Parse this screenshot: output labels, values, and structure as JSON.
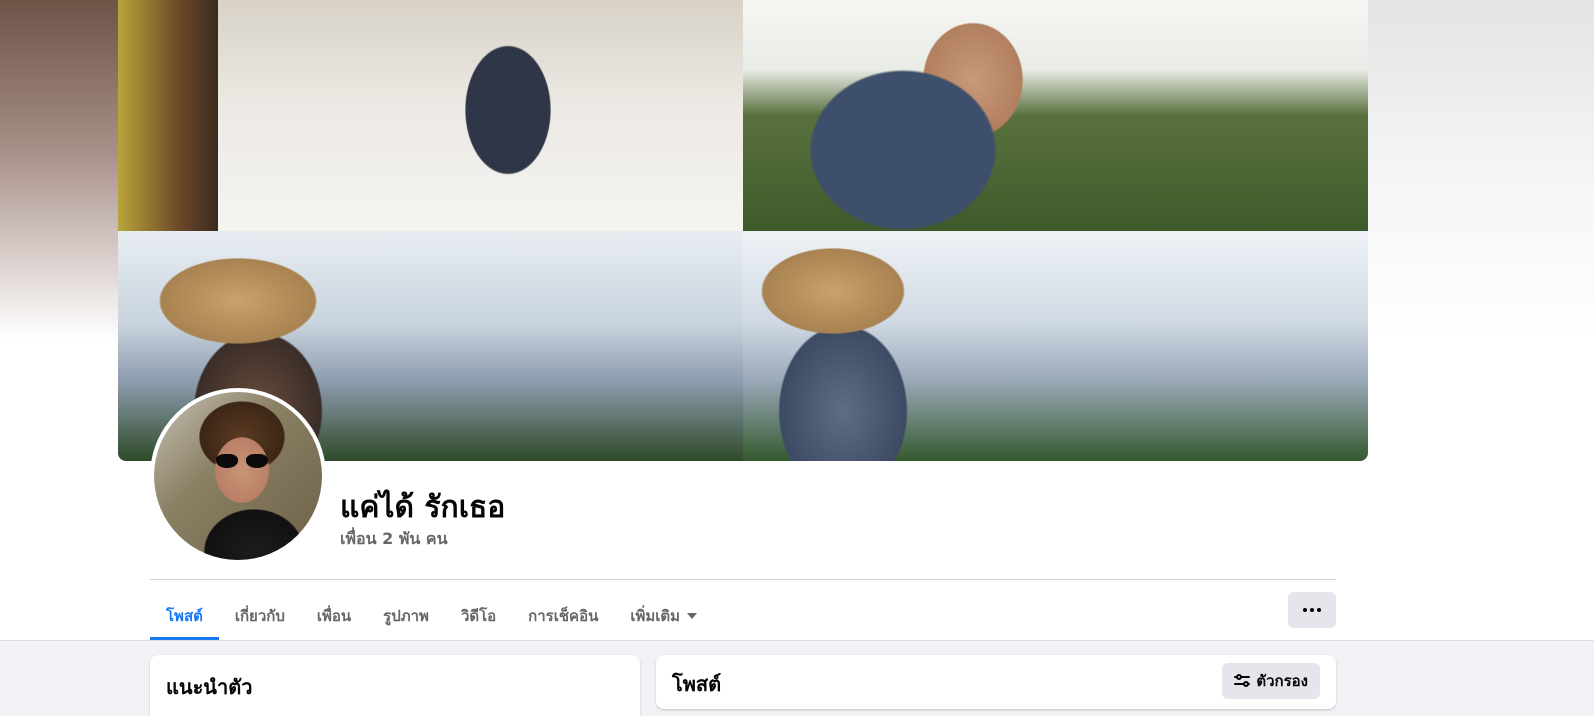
{
  "profile": {
    "name": "แค่ได้ รักเธอ",
    "friends": "เพื่อน 2 พัน คน"
  },
  "tabs": [
    {
      "label": "โพสต์",
      "active": true
    },
    {
      "label": "เกี่ยวกับ",
      "active": false
    },
    {
      "label": "เพื่อน",
      "active": false
    },
    {
      "label": "รูปภาพ",
      "active": false
    },
    {
      "label": "วิดีโอ",
      "active": false
    },
    {
      "label": "การเช็คอิน",
      "active": false
    },
    {
      "label": "เพิ่มเติม",
      "active": false
    }
  ],
  "more_button": {
    "icon": "more-horizontal-icon"
  },
  "intro": {
    "title": "แนะนำตัว"
  },
  "posts": {
    "title": "โพสต์",
    "filter_label": "ตัวกรอง",
    "filter_icon": "filter-sliders-icon"
  },
  "colors": {
    "accent": "#1877f2",
    "page_bg": "#f0f2f5",
    "secondary_text": "#65676b",
    "button_bg": "#e4e6eb"
  }
}
